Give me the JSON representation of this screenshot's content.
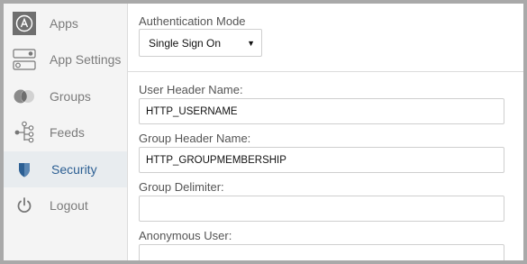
{
  "sidebar": {
    "items": [
      {
        "label": "Apps",
        "icon": "apps-icon"
      },
      {
        "label": "App Settings",
        "icon": "toggle-switches-icon"
      },
      {
        "label": "Groups",
        "icon": "groups-circles-icon"
      },
      {
        "label": "Feeds",
        "icon": "feeds-tree-icon"
      },
      {
        "label": "Security",
        "icon": "shield-icon",
        "active": true
      },
      {
        "label": "Logout",
        "icon": "power-icon"
      }
    ]
  },
  "auth": {
    "mode_label": "Authentication Mode",
    "mode_value": "Single Sign On"
  },
  "form": {
    "user_header_label": "User Header Name:",
    "user_header_value": "HTTP_USERNAME",
    "group_header_label": "Group Header Name:",
    "group_header_value": "HTTP_GROUPMEMBERSHIP",
    "group_delimiter_label": "Group Delimiter:",
    "group_delimiter_value": "",
    "anonymous_user_label": "Anonymous User:",
    "anonymous_user_value": ""
  },
  "colors": {
    "active_accent": "#2c5f93",
    "sidebar_bg": "#f4f4f4",
    "active_bg": "#e8ecef"
  }
}
